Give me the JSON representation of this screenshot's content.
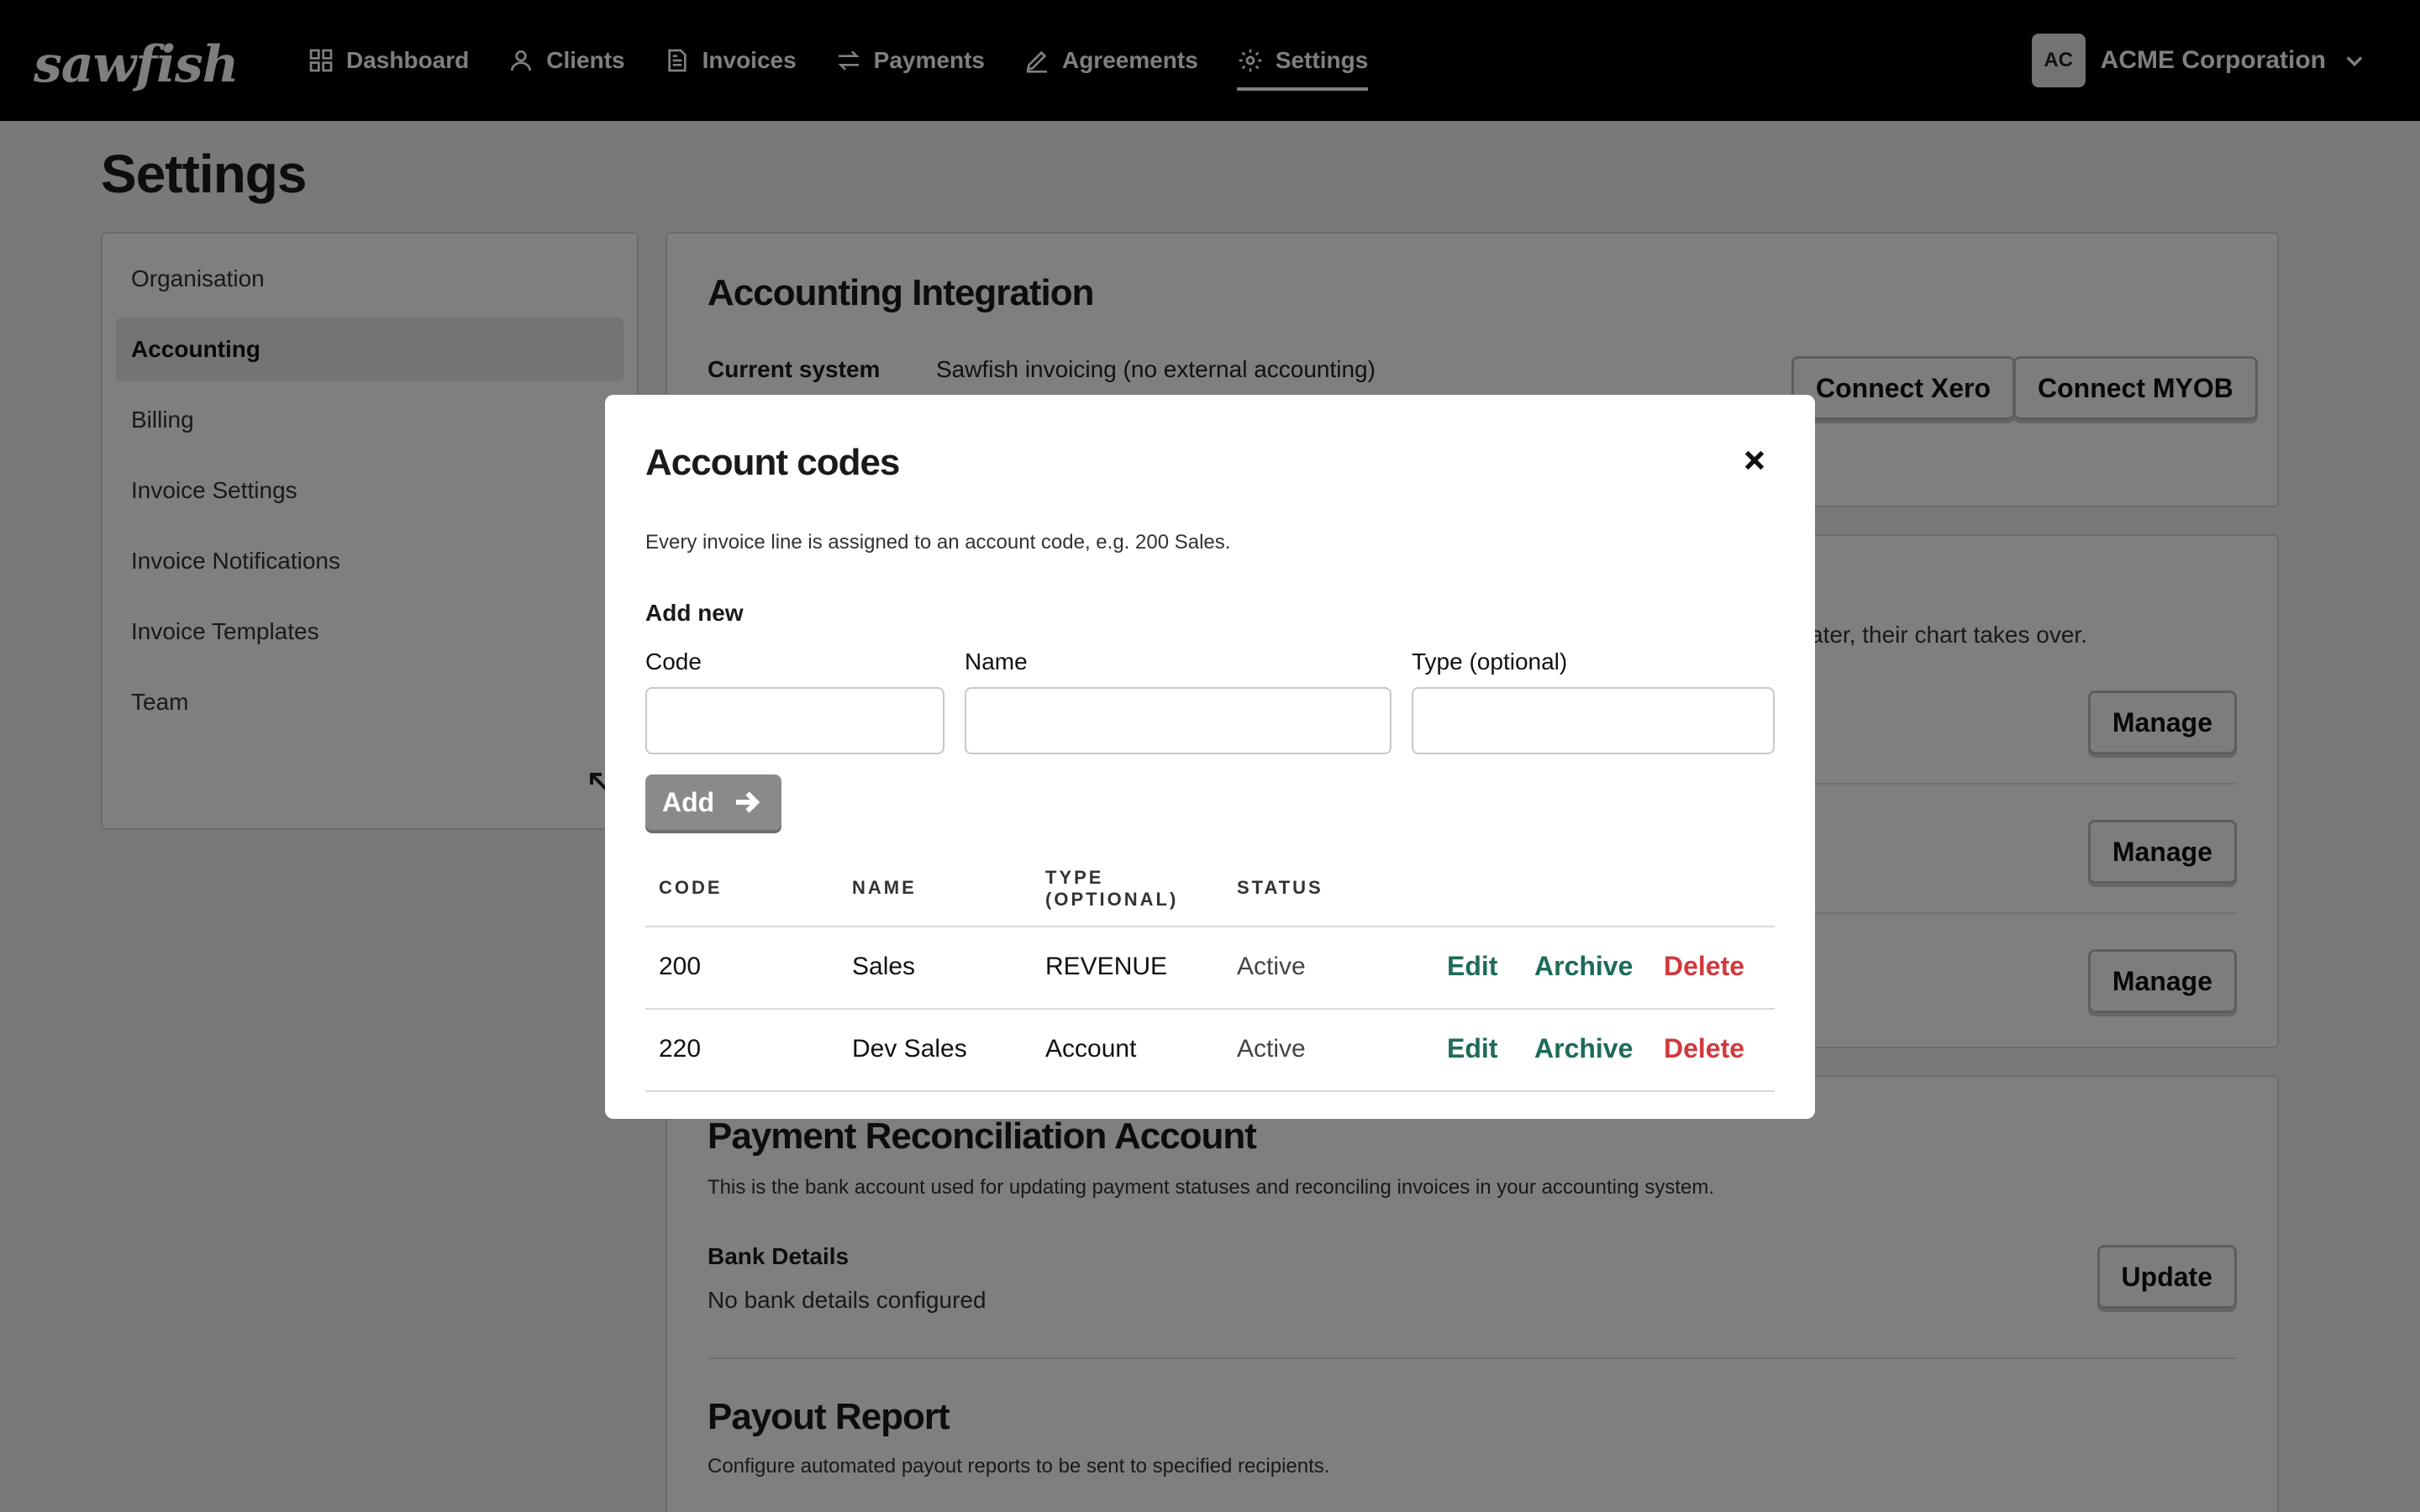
{
  "app": {
    "logo": "sawfish"
  },
  "nav": {
    "items": [
      {
        "label": "Dashboard",
        "icon": "dashboard-icon"
      },
      {
        "label": "Clients",
        "icon": "user-icon"
      },
      {
        "label": "Invoices",
        "icon": "invoice-icon"
      },
      {
        "label": "Payments",
        "icon": "arrows-icon"
      },
      {
        "label": "Agreements",
        "icon": "signature-icon"
      },
      {
        "label": "Settings",
        "icon": "gear-icon",
        "active": true
      }
    ],
    "org_initials": "AC",
    "org_name": "ACME Corporation"
  },
  "page": {
    "title": "Settings"
  },
  "sidebar": {
    "items": [
      {
        "label": "Organisation"
      },
      {
        "label": "Accounting",
        "active": true
      },
      {
        "label": "Billing"
      },
      {
        "label": "Invoice Settings"
      },
      {
        "label": "Invoice Notifications"
      },
      {
        "label": "Invoice Templates"
      },
      {
        "label": "Team"
      }
    ]
  },
  "integration": {
    "title": "Accounting Integration",
    "current_label": "Current system",
    "current_value": "Sawfish invoicing (no external accounting)",
    "connect_xero": "Connect Xero",
    "connect_myob": "Connect MYOB"
  },
  "chart_section": {
    "text_fragment": "ater, their chart takes over.",
    "manage_label": "Manage"
  },
  "reconciliation": {
    "title": "Payment Reconciliation Account",
    "description": "This is the bank account used for updating payment statuses and reconciling invoices in your accounting system.",
    "bank_label": "Bank Details",
    "bank_value": "No bank details configured",
    "update_label": "Update"
  },
  "payout": {
    "title": "Payout Report",
    "description": "Configure automated payout reports to be sent to specified recipients."
  },
  "modal": {
    "title": "Account codes",
    "description": "Every invoice line is assigned to an account code, e.g. 200 Sales.",
    "add_new": "Add new",
    "code_label": "Code",
    "name_label": "Name",
    "type_label": "Type (optional)",
    "code_value": "",
    "name_value": "",
    "type_value": "",
    "add_button": "Add",
    "headers": {
      "code": "CODE",
      "name": "NAME",
      "type": "TYPE (OPTIONAL)",
      "status": "STATUS"
    },
    "rows": [
      {
        "code": "200",
        "name": "Sales",
        "type": "REVENUE",
        "status": "Active"
      },
      {
        "code": "220",
        "name": "Dev Sales",
        "type": "Account",
        "status": "Active"
      }
    ],
    "actions": {
      "edit": "Edit",
      "archive": "Archive",
      "delete": "Delete"
    }
  },
  "colors": {
    "accent_green": "#1e6b5a",
    "danger_red": "#d0393f"
  }
}
